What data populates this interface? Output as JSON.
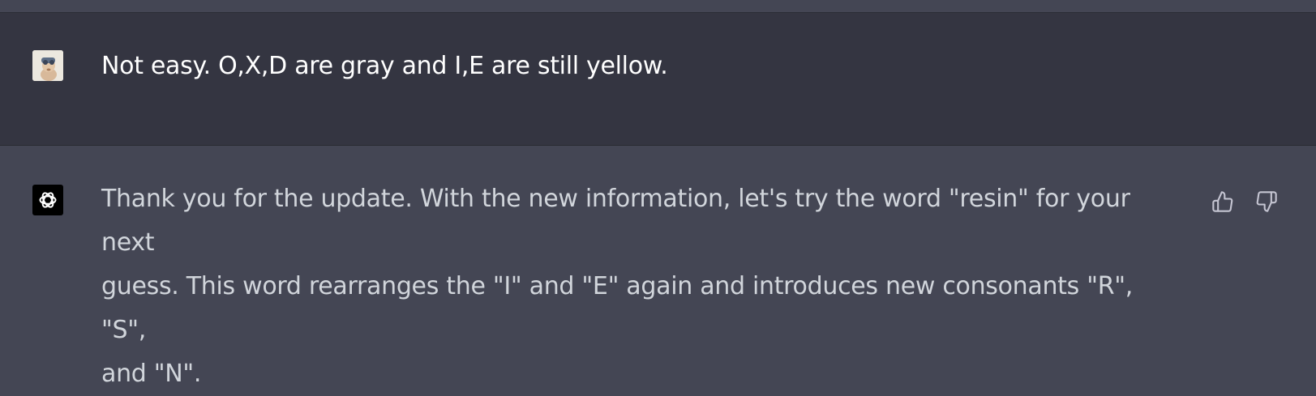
{
  "conversation": {
    "user_message": {
      "avatar_icon": "user-avatar-icon",
      "text": "Not easy. O,X,D are gray and I,E are still yellow."
    },
    "assistant_message": {
      "avatar_icon": "openai-logo-icon",
      "text": "Thank you for the update. With the new information, let's try the word \"resin\" for your next\nguess. This word rearranges the \"I\" and \"E\" again and introduces new consonants \"R\", \"S\",\nand \"N\"."
    },
    "feedback": {
      "thumbs_up_icon": "thumbs-up-icon",
      "thumbs_down_icon": "thumbs-down-icon"
    }
  },
  "colors": {
    "user_row_bg": "#343541",
    "assistant_row_bg": "#444654",
    "user_text": "#ffffff",
    "assistant_text": "#d1d5db"
  }
}
